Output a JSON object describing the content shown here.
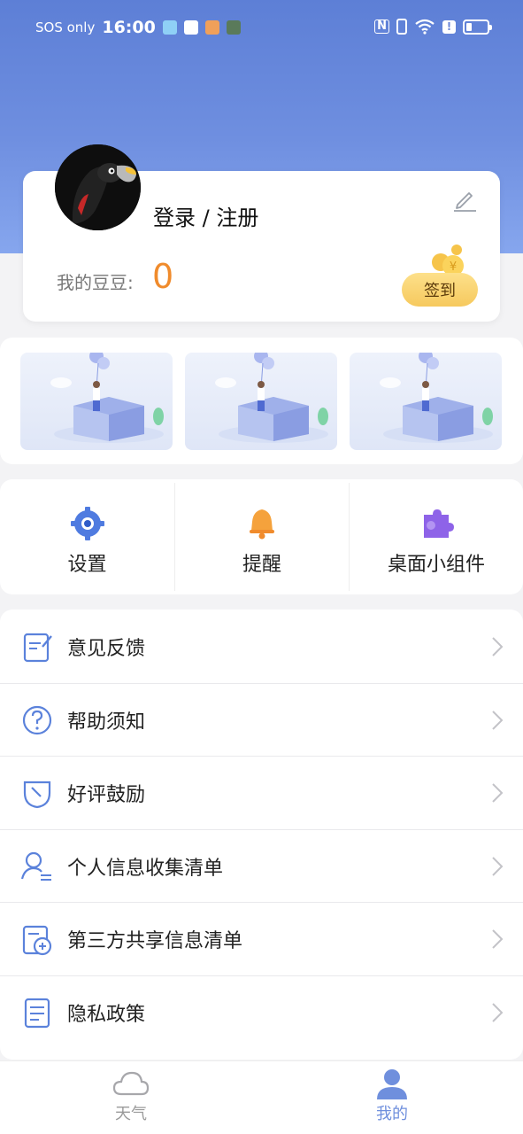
{
  "status_bar": {
    "carrier": "SOS only",
    "time": "16:00",
    "app_icons": [
      "weather-app-icon",
      "upload-app-icon",
      "novel-app-icon",
      "game-app-icon"
    ],
    "right_icons": [
      "nfc-icon",
      "vibrate-icon",
      "wifi-icon",
      "alert-icon",
      "battery-icon"
    ],
    "nfc_label": "N",
    "alert_label": "!"
  },
  "profile": {
    "login_label": "登录 / 注册",
    "beans_label": "我的豆豆:",
    "beans_value": "0",
    "checkin_label": "签到"
  },
  "banners": [
    {
      "icon": "box-balloon-illustration"
    },
    {
      "icon": "box-balloon-illustration"
    },
    {
      "icon": "box-balloon-illustration"
    }
  ],
  "quick_actions": [
    {
      "label": "设置",
      "icon": "gear-icon"
    },
    {
      "label": "提醒",
      "icon": "bell-icon"
    },
    {
      "label": "桌面小组件",
      "icon": "puzzle-icon"
    }
  ],
  "menu": [
    {
      "label": "意见反馈",
      "icon": "feedback-icon"
    },
    {
      "label": "帮助须知",
      "icon": "help-icon"
    },
    {
      "label": "好评鼓励",
      "icon": "rate-icon"
    },
    {
      "label": "个人信息收集清单",
      "icon": "personal-info-icon"
    },
    {
      "label": "第三方共享信息清单",
      "icon": "share-info-icon"
    },
    {
      "label": "隐私政策",
      "icon": "privacy-icon"
    }
  ],
  "tabs": [
    {
      "label": "天气",
      "icon": "cloud-icon",
      "active": false
    },
    {
      "label": "我的",
      "icon": "person-icon",
      "active": true
    }
  ],
  "colors": {
    "header_gradient_top": "#5d7fd6",
    "accent_orange": "#f08b2c",
    "checkin_yellow": "#f6c95e",
    "active_tab": "#6f8fdd",
    "inactive_tab": "#9a9a9a"
  }
}
